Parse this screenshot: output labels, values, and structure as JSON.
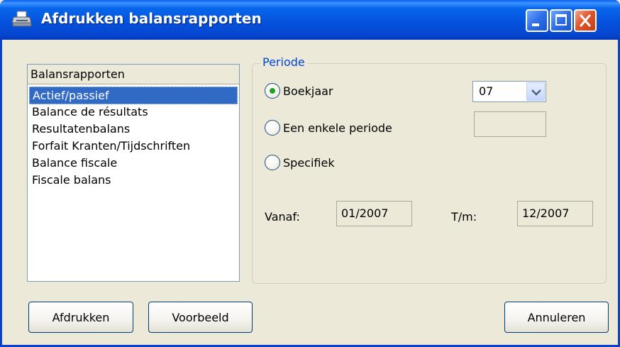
{
  "window": {
    "title": "Afdrukken balansrapporten",
    "icon": "printer-icon",
    "controls": [
      "minimize-icon",
      "maximize-icon",
      "close-icon"
    ]
  },
  "report_list": {
    "header": "Balansrapporten",
    "items": [
      "Actief/passief",
      "Balance de résultats",
      "Resultatenbalans",
      "Forfait Kranten/Tijdschriften",
      "Balance fiscale",
      "Fiscale balans"
    ],
    "selected_index": 0
  },
  "period": {
    "legend": "Periode",
    "options": {
      "boekjaar": "Boekjaar",
      "enkele_periode": "Een enkele periode",
      "specifiek": "Specifiek"
    },
    "selected": "boekjaar",
    "boekjaar_value": "07",
    "enkele_periode_value": "",
    "vanaf_label": "Vanaf:",
    "vanaf_value": "01/2007",
    "tm_label": "T/m:",
    "tm_value": "12/2007"
  },
  "buttons": {
    "print": "Afdrukken",
    "preview": "Voorbeeld",
    "cancel": "Annuleren"
  },
  "colors": {
    "titlebar": "#0550da",
    "selection": "#316ac5",
    "legend": "#0046d5",
    "radio_dot": "#21a121",
    "close_button": "#e0562c"
  }
}
